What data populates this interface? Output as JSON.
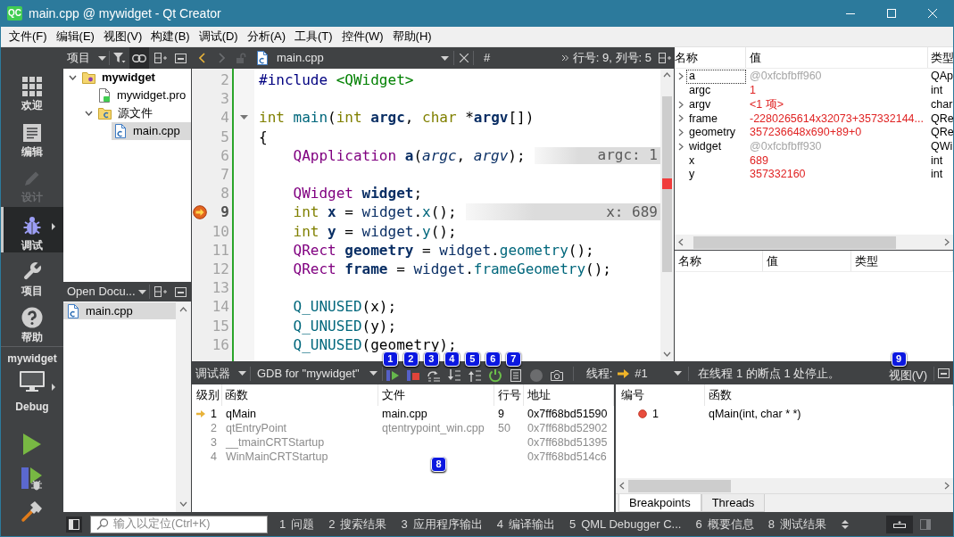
{
  "window": {
    "logo": "QC",
    "title": "main.cpp @ mywidget - Qt Creator"
  },
  "menu_bar": [
    "文件(F)",
    "编辑(E)",
    "视图(V)",
    "构建(B)",
    "调试(D)",
    "分析(A)",
    "工具(T)",
    "控件(W)",
    "帮助(H)"
  ],
  "mode_bar": {
    "modes": [
      {
        "kind": "welcome",
        "label": "欢迎",
        "selected": false,
        "disabled": false
      },
      {
        "kind": "edit",
        "label": "编辑",
        "selected": false,
        "disabled": false
      },
      {
        "kind": "design",
        "label": "设计",
        "selected": false,
        "disabled": true
      },
      {
        "kind": "debug",
        "label": "调试",
        "selected": true,
        "disabled": false
      },
      {
        "kind": "projects",
        "label": "项目",
        "selected": false,
        "disabled": false
      },
      {
        "kind": "help",
        "label": "帮助",
        "selected": false,
        "disabled": false
      }
    ],
    "kit": {
      "project": "mywidget",
      "build_config": "Debug"
    }
  },
  "project_pane": {
    "title": "项目",
    "tree": [
      {
        "label": "mywidget",
        "kind": "project",
        "expanded": true,
        "selected": false,
        "children": [
          {
            "label": "mywidget.pro",
            "kind": "pro",
            "selected": false
          },
          {
            "label": "源文件",
            "kind": "folder",
            "expanded": true,
            "selected": false,
            "children": [
              {
                "label": "main.cpp",
                "kind": "cpp",
                "selected": true
              }
            ]
          }
        ]
      }
    ]
  },
  "open_documents": {
    "title": "Open Docu...",
    "items": [
      {
        "label": "main.cpp",
        "selected": true
      }
    ]
  },
  "editor": {
    "toolbar": {
      "file": "main.cpp",
      "symbol": "#",
      "position": "行号: 9, 列号: 5"
    },
    "lines": [
      {
        "number": "2",
        "current": false,
        "foldable": false,
        "tokens": [
          {
            "text": "#include",
            "kind": "preprocessor"
          },
          {
            "text": " <QWidget>",
            "kind": "string"
          }
        ]
      },
      {
        "number": "3",
        "current": false,
        "foldable": false
      },
      {
        "number": "4",
        "current": false,
        "foldable": true,
        "tokens": [
          {
            "text": "int",
            "kind": "keyword"
          },
          {
            "text": " main",
            "kind": "function"
          },
          {
            "text": "(",
            "kind": "plain"
          },
          {
            "text": "int",
            "kind": "keyword"
          },
          {
            "text": " argc",
            "kind": "declaration"
          },
          {
            "text": ", ",
            "kind": "plain"
          },
          {
            "text": "char",
            "kind": "keyword"
          },
          {
            "text": " *",
            "kind": "plain"
          },
          {
            "text": "argv",
            "kind": "declaration"
          },
          {
            "text": "[])",
            "kind": "plain"
          }
        ]
      },
      {
        "number": "5",
        "current": false,
        "foldable": false,
        "tokens": [
          {
            "text": "{",
            "kind": "plain"
          }
        ]
      },
      {
        "number": "6",
        "current": false,
        "foldable": false,
        "tokens": [
          {
            "text": "    QApplication",
            "kind": "type"
          },
          {
            "text": " a",
            "kind": "declaration"
          },
          {
            "text": "(",
            "kind": "plain"
          },
          {
            "text": "argc",
            "kind": "parameter"
          },
          {
            "text": ", ",
            "kind": "plain"
          },
          {
            "text": "argv",
            "kind": "parameter"
          },
          {
            "text": ");",
            "kind": "plain"
          }
        ],
        "annotation": "argc: 1"
      },
      {
        "number": "7",
        "current": false,
        "foldable": false
      },
      {
        "number": "8",
        "current": false,
        "foldable": false,
        "tokens": [
          {
            "text": "    QWidget",
            "kind": "type"
          },
          {
            "text": " widget",
            "kind": "declaration"
          },
          {
            "text": ";",
            "kind": "plain"
          }
        ]
      },
      {
        "number": "9",
        "current": true,
        "foldable": false,
        "tokens": [
          {
            "text": "    int",
            "kind": "keyword"
          },
          {
            "text": " x",
            "kind": "declaration"
          },
          {
            "text": " = ",
            "kind": "plain"
          },
          {
            "text": "widget",
            "kind": "local"
          },
          {
            "text": ".",
            "kind": "plain"
          },
          {
            "text": "x",
            "kind": "function"
          },
          {
            "text": "();",
            "kind": "plain"
          }
        ],
        "annotation": "x: 689"
      },
      {
        "number": "10",
        "current": false,
        "foldable": false,
        "tokens": [
          {
            "text": "    int",
            "kind": "keyword"
          },
          {
            "text": " y",
            "kind": "declaration"
          },
          {
            "text": " = ",
            "kind": "plain"
          },
          {
            "text": "widget",
            "kind": "local"
          },
          {
            "text": ".",
            "kind": "plain"
          },
          {
            "text": "y",
            "kind": "function"
          },
          {
            "text": "();",
            "kind": "plain"
          }
        ]
      },
      {
        "number": "11",
        "current": false,
        "foldable": false,
        "tokens": [
          {
            "text": "    QRect",
            "kind": "type"
          },
          {
            "text": " geometry",
            "kind": "declaration"
          },
          {
            "text": " = ",
            "kind": "plain"
          },
          {
            "text": "widget",
            "kind": "local"
          },
          {
            "text": ".",
            "kind": "plain"
          },
          {
            "text": "geometry",
            "kind": "function"
          },
          {
            "text": "();",
            "kind": "plain"
          }
        ]
      },
      {
        "number": "12",
        "current": false,
        "foldable": false,
        "tokens": [
          {
            "text": "    QRect",
            "kind": "type"
          },
          {
            "text": " frame",
            "kind": "declaration"
          },
          {
            "text": " = ",
            "kind": "plain"
          },
          {
            "text": "widget",
            "kind": "local"
          },
          {
            "text": ".",
            "kind": "plain"
          },
          {
            "text": "frameGeometry",
            "kind": "function"
          },
          {
            "text": "();",
            "kind": "plain"
          }
        ]
      },
      {
        "number": "13",
        "current": false,
        "foldable": false
      },
      {
        "number": "14",
        "current": false,
        "foldable": false,
        "tokens": [
          {
            "text": "    Q_UNUSED",
            "kind": "macro"
          },
          {
            "text": "(x);",
            "kind": "plain"
          }
        ]
      },
      {
        "number": "15",
        "current": false,
        "foldable": false,
        "tokens": [
          {
            "text": "    Q_UNUSED",
            "kind": "macro"
          },
          {
            "text": "(y);",
            "kind": "plain"
          }
        ]
      },
      {
        "number": "16",
        "current": false,
        "foldable": false,
        "tokens": [
          {
            "text": "    Q_UNUSED",
            "kind": "macro"
          },
          {
            "text": "(geometry);",
            "kind": "plain"
          }
        ]
      }
    ]
  },
  "locals": {
    "columns": [
      "名称",
      "值",
      "类型"
    ],
    "rows": [
      {
        "name": "a",
        "value": "@0xfcbfbff960",
        "type": "QAp",
        "expandable": true,
        "changed": false,
        "focused": true
      },
      {
        "name": "argc",
        "value": "1",
        "type": "int",
        "expandable": false,
        "changed": true,
        "focused": false
      },
      {
        "name": "argv",
        "value": "<1 项>",
        "type": "char",
        "expandable": true,
        "changed": true,
        "focused": false
      },
      {
        "name": "frame",
        "value": "-2280265614x32073+357332144...",
        "type": "QRe",
        "expandable": true,
        "changed": true,
        "focused": false
      },
      {
        "name": "geometry",
        "value": "357236648x690+89+0",
        "type": "QRe",
        "expandable": true,
        "changed": true,
        "focused": false
      },
      {
        "name": "widget",
        "value": "@0xfcbfbff930",
        "type": "QWi",
        "expandable": true,
        "changed": false,
        "focused": false
      },
      {
        "name": "x",
        "value": "689",
        "type": "int",
        "expandable": false,
        "changed": true,
        "focused": false
      },
      {
        "name": "y",
        "value": "357332160",
        "type": "int",
        "expandable": false,
        "changed": true,
        "focused": false
      }
    ]
  },
  "expressions": {
    "columns": [
      "名称",
      "值",
      "类型"
    ]
  },
  "debug_toolbar": {
    "engine_label": "调试器",
    "engine": "GDB for \"mywidget\"",
    "buttons": [
      {
        "kind": "continue",
        "disabled": false,
        "callout": "1"
      },
      {
        "kind": "stop",
        "disabled": false,
        "callout": "2"
      },
      {
        "kind": "step_over",
        "disabled": false,
        "callout": "3"
      },
      {
        "kind": "step_into",
        "disabled": false,
        "callout": "4"
      },
      {
        "kind": "step_out",
        "disabled": false,
        "callout": "5"
      },
      {
        "kind": "restart",
        "disabled": false,
        "callout": "6"
      },
      {
        "kind": "instructions",
        "disabled": false,
        "callout": "7"
      },
      {
        "kind": "record",
        "disabled": true
      },
      {
        "kind": "snapshot",
        "disabled": false
      }
    ],
    "thread_label": "线程:",
    "thread": "#1",
    "status": "在线程 1 的断点 1 处停止。",
    "views_menu": {
      "label": "视图(V)",
      "callout": "9"
    }
  },
  "stack": {
    "columns": [
      "级别",
      "函数",
      "文件",
      "行号",
      "地址"
    ],
    "callout": "8",
    "rows": [
      {
        "level": "1",
        "function": "qMain",
        "file": "main.cpp",
        "line": "9",
        "address": "0x7ff68bd51590",
        "current": true,
        "usable": true
      },
      {
        "level": "2",
        "function": "qtEntryPoint",
        "file": "qtentrypoint_win.cpp",
        "line": "50",
        "address": "0x7ff68bd52902",
        "current": false,
        "usable": false
      },
      {
        "level": "3",
        "function": "__tmainCRTStartup",
        "address": "0x7ff68bd51395",
        "current": false,
        "usable": false
      },
      {
        "level": "4",
        "function": "WinMainCRTStartup",
        "address": "0x7ff68bd514c6",
        "current": false,
        "usable": false
      }
    ]
  },
  "breakpoints": {
    "columns": [
      "编号",
      "函数"
    ],
    "rows": [
      {
        "number": "1",
        "function": "qMain(int, char * *)"
      }
    ],
    "tabs": [
      {
        "label": "Breakpoints",
        "selected": true
      },
      {
        "label": "Threads",
        "selected": false
      }
    ]
  },
  "status_bar": {
    "locator": {
      "placeholder": "输入以定位(Ctrl+K)"
    },
    "output_panes": [
      {
        "number": "1",
        "label": "问题"
      },
      {
        "number": "2",
        "label": "搜索结果"
      },
      {
        "number": "3",
        "label": "应用程序输出"
      },
      {
        "number": "4",
        "label": "编译输出"
      },
      {
        "number": "5",
        "label": "QML Debugger C..."
      },
      {
        "number": "6",
        "label": "概要信息"
      },
      {
        "number": "8",
        "label": "测试结果"
      }
    ]
  }
}
